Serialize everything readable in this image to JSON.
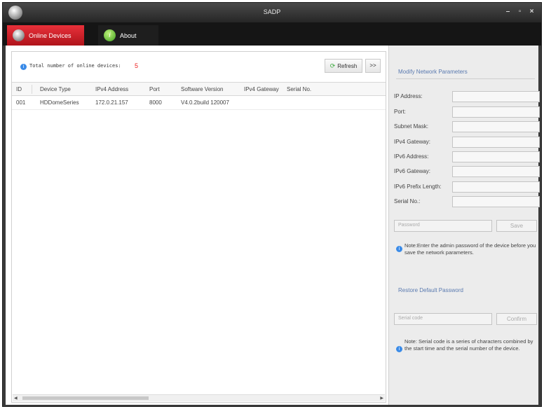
{
  "window": {
    "title": "SADP",
    "controls": {
      "minimize": "–",
      "maximize": "▫",
      "close": "×"
    }
  },
  "tabs": [
    {
      "label": "Online Devices",
      "icon": "camera-icon",
      "active": true
    },
    {
      "label": "About",
      "icon": "info-icon",
      "active": false
    }
  ],
  "toolbar": {
    "total_label": "Total number of online devices:",
    "total_count": "5",
    "refresh_label": "Refresh",
    "more_label": ">>"
  },
  "device_table": {
    "columns": [
      "ID",
      "Device Type",
      "IPv4 Address",
      "Port",
      "Software Version",
      "IPv4 Gateway",
      "Serial No."
    ],
    "rows": [
      [
        "001",
        "HDDomeSeries",
        "172.0.21.157",
        "8000",
        "V4.0.2build 120007",
        "",
        ""
      ]
    ]
  },
  "modify_panel": {
    "title": "Modify Network Parameters",
    "fields": [
      {
        "label": "IP Address:",
        "value": ""
      },
      {
        "label": "Port:",
        "value": ""
      },
      {
        "label": "Subnet Mask:",
        "value": ""
      },
      {
        "label": "IPv4 Gateway:",
        "value": ""
      },
      {
        "label": "IPv6 Address:",
        "value": ""
      },
      {
        "label": "IPv6 Gateway:",
        "value": ""
      },
      {
        "label": "IPv6 Prefix Length:",
        "value": ""
      },
      {
        "label": "Serial No.:",
        "value": ""
      }
    ],
    "password_placeholder": "Password",
    "save_label": "Save",
    "note": "Note:Enter the admin password of the device before you save the network parameters."
  },
  "restore_panel": {
    "title": "Restore Default Password",
    "serial_code_placeholder": "Serial code",
    "confirm_label": "Confirm",
    "note": "Note: Serial code is a series of characters combined by the start time and the serial number of the device."
  },
  "colors": {
    "active_tab": "#d3202a",
    "titlebar": "#333333",
    "section_title": "#5a7ab0",
    "count": "#ee2222"
  }
}
